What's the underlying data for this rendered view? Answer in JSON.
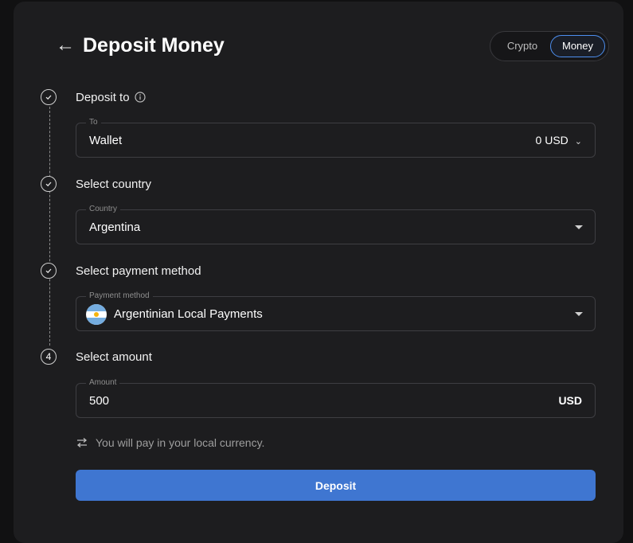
{
  "header": {
    "back_icon": "arrow-left-icon",
    "title": "Deposit Money"
  },
  "toggle": {
    "crypto_label": "Crypto",
    "money_label": "Money",
    "selected": "Money"
  },
  "steps": [
    {
      "label": "Deposit to",
      "marker": "check",
      "has_info_icon": true
    },
    {
      "label": "Select country",
      "marker": "check"
    },
    {
      "label": "Select payment method",
      "marker": "check"
    },
    {
      "label": "Select amount",
      "marker": "4"
    }
  ],
  "fields": {
    "to": {
      "legend": "To",
      "value": "Wallet",
      "balance": "0 USD"
    },
    "country": {
      "legend": "Country",
      "value": "Argentina"
    },
    "payment_method": {
      "legend": "Payment method",
      "value": "Argentinian Local Payments",
      "flag_icon": "argentina-flag-icon"
    },
    "amount": {
      "legend": "Amount",
      "value": "500",
      "currency": "USD"
    }
  },
  "note": {
    "icon": "swap-arrows-icon",
    "text": "You will pay in your local currency."
  },
  "deposit_button": {
    "label": "Deposit"
  },
  "colors": {
    "accent": "#3f76d1",
    "panel": "#1d1d1f",
    "background": "#111112",
    "toggle_border": "#4d8ff0"
  }
}
